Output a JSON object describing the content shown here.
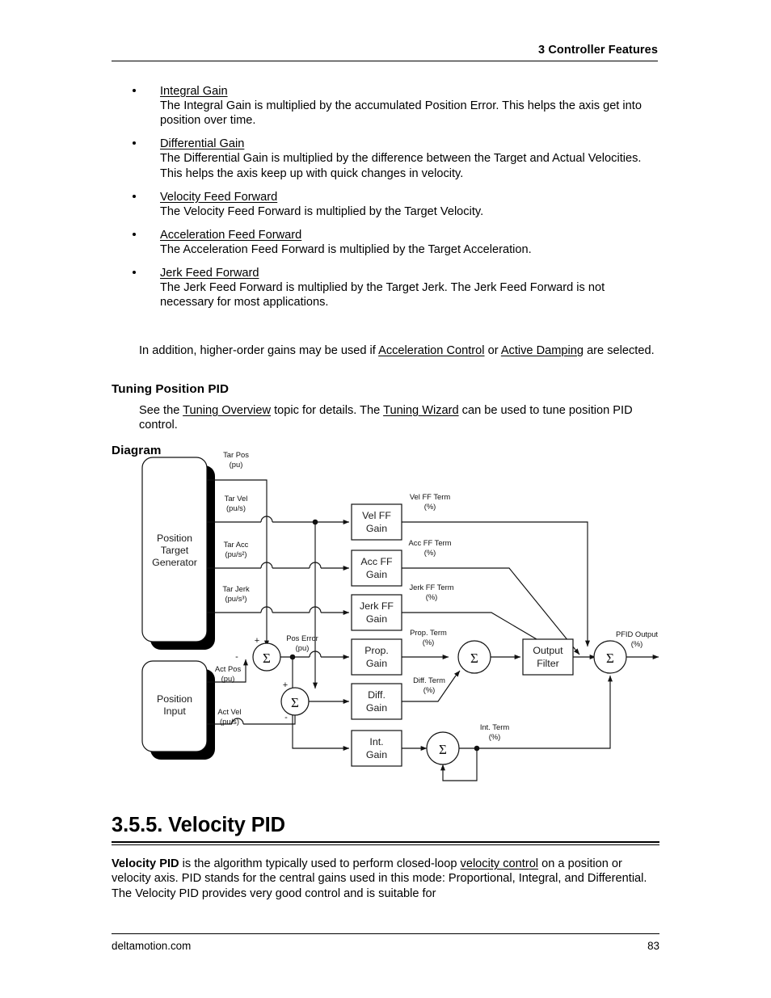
{
  "header": {
    "chapter_number": "3",
    "chapter_title": "Controller Features",
    "full": "3  Controller Features"
  },
  "bullets": [
    {
      "term": "Integral Gain",
      "description": "The Integral Gain is multiplied by the accumulated Position Error. This helps the axis get into position over time."
    },
    {
      "term": "Differential Gain",
      "description": "The Differential Gain is multiplied by the difference between the Target and Actual Velocities. This helps the axis keep up with quick changes in velocity."
    },
    {
      "term": "Velocity Feed Forward",
      "description": "The Velocity Feed Forward is multiplied by the Target Velocity."
    },
    {
      "term": "Acceleration Feed Forward",
      "description": "The Acceleration Feed Forward is multiplied by the Target Acceleration."
    },
    {
      "term": "Jerk Feed Forward",
      "description": "The Jerk Feed Forward is multiplied by the Target Jerk. The Jerk Feed Forward is not necessary for most applications."
    }
  ],
  "note_paragraph": {
    "part1": "In addition, higher-order gains may be used if ",
    "link1": "Acceleration Control",
    "part2": " or ",
    "link2": "Active Damping",
    "part3": " are selected."
  },
  "tuning": {
    "heading": "Tuning Position PID",
    "part1": "See the ",
    "link1": "Tuning Overview",
    "part2": " topic for details. The ",
    "link2": "Tuning Wizard",
    "part3": " can be used to tune position PID control."
  },
  "diagram": {
    "heading": "Diagram",
    "blocks": {
      "position_target_generator": "Position\nTarget\nGenerator",
      "ptg_line1": "Position",
      "ptg_line2": "Target",
      "ptg_line3": "Generator",
      "position_input_line1": "Position",
      "position_input_line2": "Input",
      "vel_ff_gain_l1": "Vel FF",
      "vel_ff_gain_l2": "Gain",
      "acc_ff_gain_l1": "Acc FF",
      "acc_ff_gain_l2": "Gain",
      "jerk_ff_gain_l1": "Jerk FF",
      "jerk_ff_gain_l2": "Gain",
      "prop_gain_l1": "Prop.",
      "prop_gain_l2": "Gain",
      "diff_gain_l1": "Diff.",
      "diff_gain_l2": "Gain",
      "int_gain_l1": "Int.",
      "int_gain_l2": "Gain",
      "output_filter_l1": "Output",
      "output_filter_l2": "Filter"
    },
    "signals": {
      "tar_pos_l1": "Tar Pos",
      "tar_pos_l2": "(pu)",
      "tar_vel_l1": "Tar Vel",
      "tar_vel_l2": "(pu/s)",
      "tar_acc_l1": "Tar Acc",
      "tar_acc_l2": "(pu/s²)",
      "tar_jerk_l1": "Tar Jerk",
      "tar_jerk_l2": "(pu/s³)",
      "act_pos_l1": "Act Pos",
      "act_pos_l2": "(pu)",
      "act_vel_l1": "Act Vel",
      "act_vel_l2": "(pu/s)",
      "pos_error_l1": "Pos Error",
      "pos_error_l2": "(pu)",
      "vel_ff_term_l1": "Vel FF Term",
      "vel_ff_term_l2": "(%)",
      "acc_ff_term_l1": "Acc FF Term",
      "acc_ff_term_l2": "(%)",
      "jerk_ff_term_l1": "Jerk FF Term",
      "jerk_ff_term_l2": "(%)",
      "prop_term_l1": "Prop. Term",
      "prop_term_l2": "(%)",
      "diff_term_l1": "Diff. Term",
      "diff_term_l2": "(%)",
      "int_term_l1": "Int. Term",
      "int_term_l2": "(%)",
      "pfid_output_l1": "PFID Output",
      "pfid_output_l2": "(%)"
    },
    "operators": {
      "sigma": "Σ",
      "plus": "+",
      "minus": "-"
    }
  },
  "section": {
    "number": "3.5.5.",
    "title": "Velocity PID",
    "heading": "3.5.5. Velocity PID",
    "body_bold": "Velocity PID",
    "body_part1": " is the algorithm typically used to perform closed-loop ",
    "body_link": "velocity control",
    "body_part2": " on a position or velocity axis. PID stands for the central gains used in this mode: Proportional, Integral, and Differential. The Velocity PID provides very good control and is suitable for"
  },
  "footer": {
    "site": "deltamotion.com",
    "page_number": "83"
  }
}
